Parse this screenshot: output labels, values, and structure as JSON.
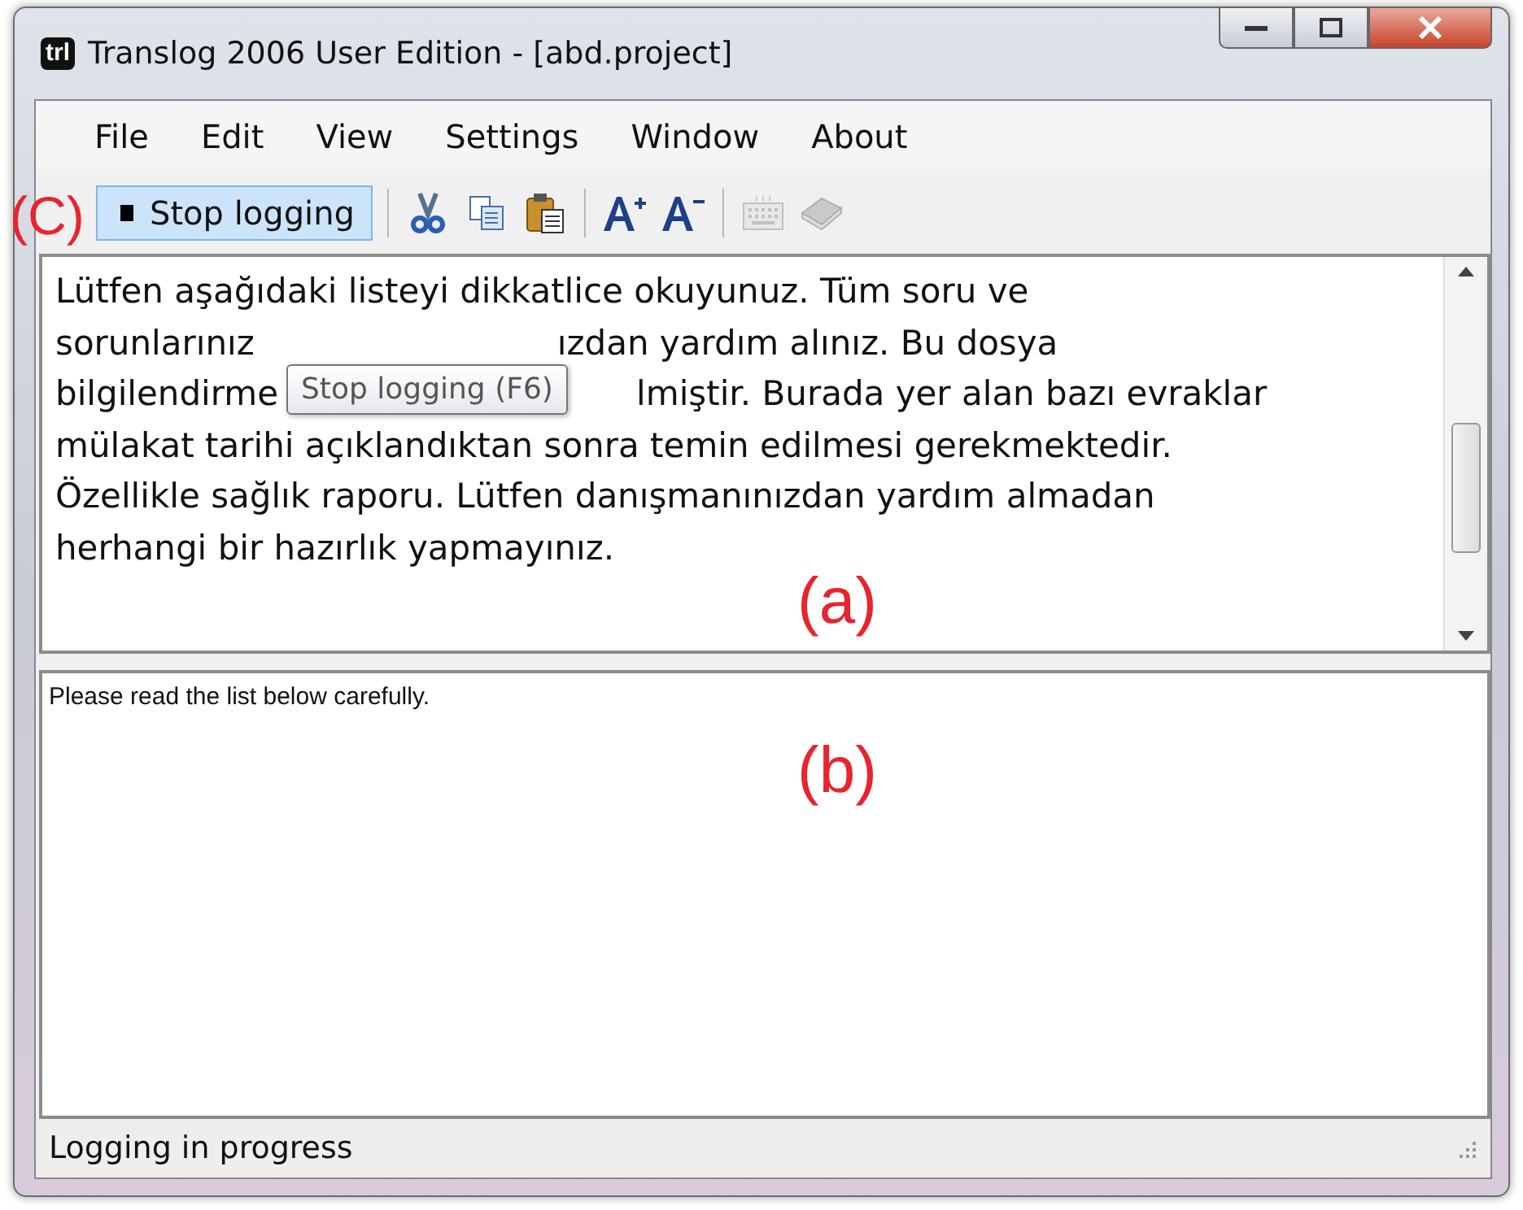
{
  "window": {
    "app_icon_text": "trl",
    "title": "Translog 2006 User Edition - [abd.project]"
  },
  "menu": [
    "File",
    "Edit",
    "View",
    "Settings",
    "Window",
    "About"
  ],
  "toolbar": [
    {
      "kind": "stop",
      "label": "Stop logging",
      "selected": true,
      "disabled": false
    },
    {
      "kind": "separator"
    },
    {
      "kind": "cut",
      "disabled": false
    },
    {
      "kind": "copy",
      "disabled": false
    },
    {
      "kind": "paste",
      "disabled": false
    },
    {
      "kind": "separator"
    },
    {
      "kind": "font-bigger",
      "disabled": false
    },
    {
      "kind": "font-smaller",
      "disabled": false
    },
    {
      "kind": "separator"
    },
    {
      "kind": "keyboard",
      "disabled": true
    },
    {
      "kind": "book",
      "disabled": true
    }
  ],
  "tooltip": "Stop logging (F6)",
  "source_pane": {
    "lines": [
      [
        "Lütfen aşağıdaki listeyi dikkatlice okuyunuz. Tüm soru ve"
      ],
      [
        "sorunlarınız",
        "ızdan yardım alınız. Bu dosya"
      ],
      [
        "bilgilendirme",
        "lmiştir. Burada yer alan bazı evraklar"
      ],
      [
        "mülakat tarihi açıklandıktan sonra temin edilmesi gerekmektedir."
      ],
      [
        "Özellikle sağlık raporu. Lütfen danışmanınızdan yardım almadan"
      ],
      [
        "herhangi bir hazırlık yapmayınız."
      ]
    ]
  },
  "target_pane": {
    "text": "Please read the list below carefully."
  },
  "status_bar": {
    "text": "Logging in progress"
  },
  "annotations": [
    {
      "kind": "c",
      "text": "(C)"
    },
    {
      "kind": "a",
      "text": "(a)"
    },
    {
      "kind": "b",
      "text": "(b)"
    }
  ]
}
